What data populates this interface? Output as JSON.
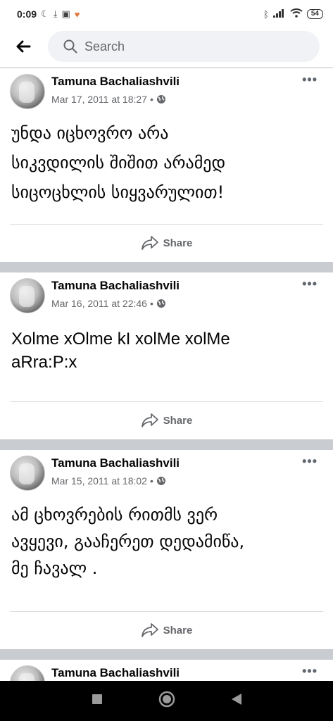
{
  "status_bar": {
    "time": "0:09",
    "battery": "54"
  },
  "search": {
    "placeholder": "Search"
  },
  "posts": [
    {
      "author": "Tamuna Bachaliashvili",
      "date": "Mar 17, 2011 at 18:27",
      "separator": "•",
      "lines": [
        "უნდა იცხოვრო არა",
        "სიკვდილის შიშით არამედ",
        "სიცოცხლის სიყვარულით!"
      ],
      "share_label": "Share"
    },
    {
      "author": "Tamuna Bachaliashvili",
      "date": "Mar 16, 2011 at 22:46",
      "separator": "•",
      "lines": [
        "Xolme xOlme kI xolMe xolMe",
        "aRra:P:x"
      ],
      "share_label": "Share"
    },
    {
      "author": "Tamuna Bachaliashvili",
      "date": "Mar 15, 2011 at 18:02",
      "separator": "•",
      "lines": [
        "ამ ცხოვრების რითმს ვერ",
        "ავყევი, გააჩერეთ დედამიწა,",
        "მე ჩავალ ."
      ],
      "share_label": "Share"
    },
    {
      "author": "Tamuna Bachaliashvili"
    }
  ]
}
